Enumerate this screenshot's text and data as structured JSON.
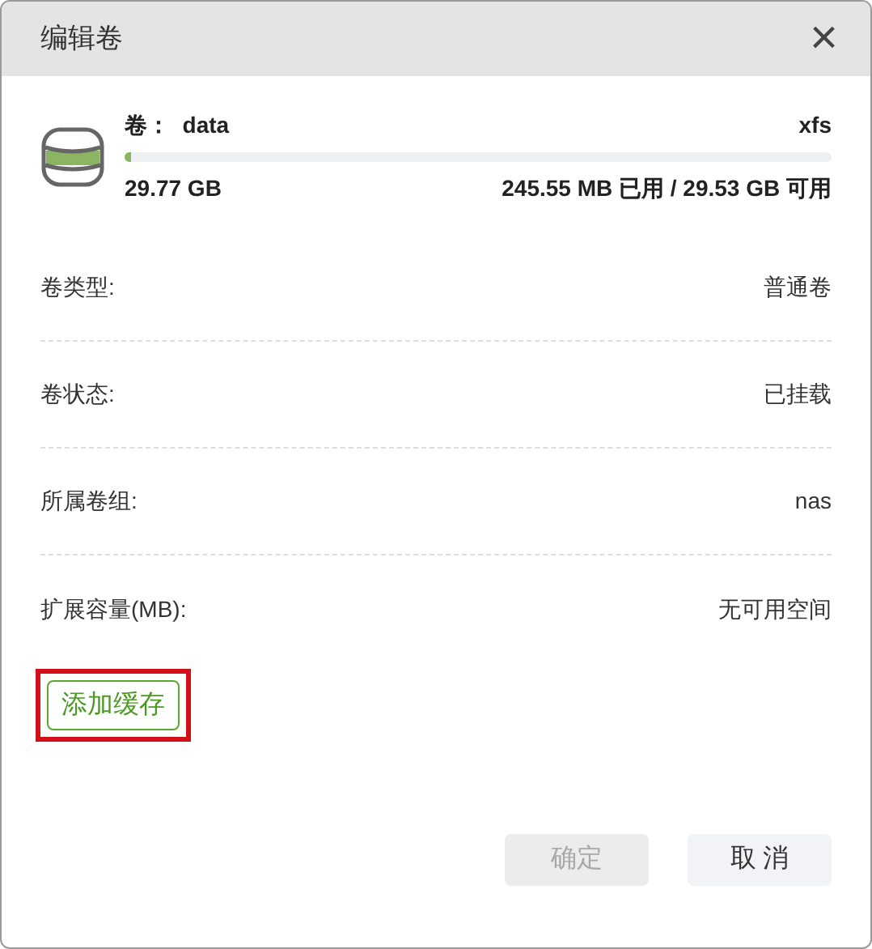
{
  "window": {
    "title": "编辑卷",
    "close": "×"
  },
  "volume": {
    "label": "卷：",
    "name": "data",
    "fs": "xfs",
    "level": 0.01,
    "total": "29.77 GB",
    "usage": "245.55 MB 已用 / 29.53 GB 可用"
  },
  "fields": [
    {
      "label": "卷类型:",
      "value": "普通卷"
    },
    {
      "label": "卷状态:",
      "value": "已挂载"
    },
    {
      "label": "所属卷组:",
      "value": "nas"
    },
    {
      "label": "扩展容量(MB):",
      "value": "无可用空间"
    }
  ],
  "add_cache": {
    "label": "添加缓存",
    "highlighted": true
  },
  "buttons": [
    {
      "label": "确定",
      "disabled": true
    },
    {
      "label": "取 消",
      "disabled": false
    }
  ]
}
